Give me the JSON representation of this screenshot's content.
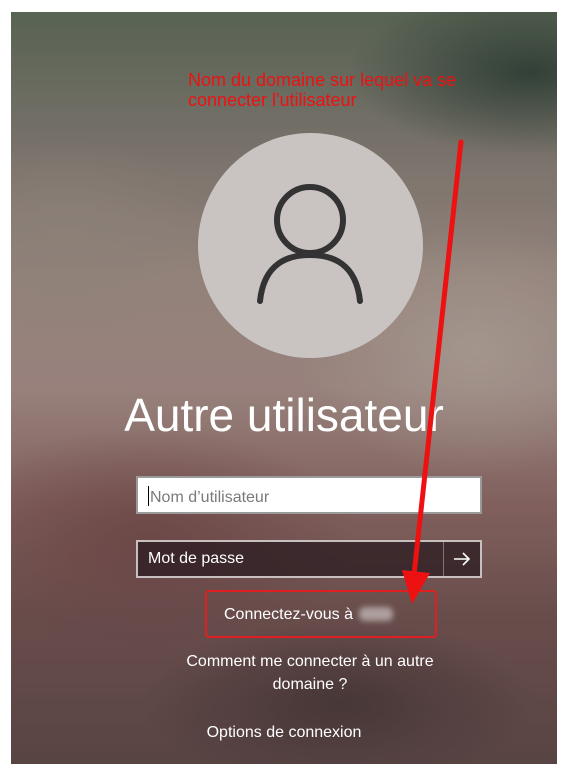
{
  "annotation": {
    "text_line1": "Nom du domaine sur lequel va se",
    "text_line2": "connecter l'utilisateur",
    "color": "#ee1111"
  },
  "login": {
    "avatar_icon": "person-icon",
    "title": "Autre utilisateur",
    "username_placeholder": "Nom d’utilisateur",
    "password_placeholder": "Mot de passe",
    "submit_icon": "arrow-right-icon",
    "connect_to_label": "Connectez-vous à",
    "other_domain_link": "Comment me connecter à un autre domaine ?",
    "options_link": "Options de connexion"
  },
  "colors": {
    "highlight_box": "#e02020",
    "text": "#ffffff"
  }
}
